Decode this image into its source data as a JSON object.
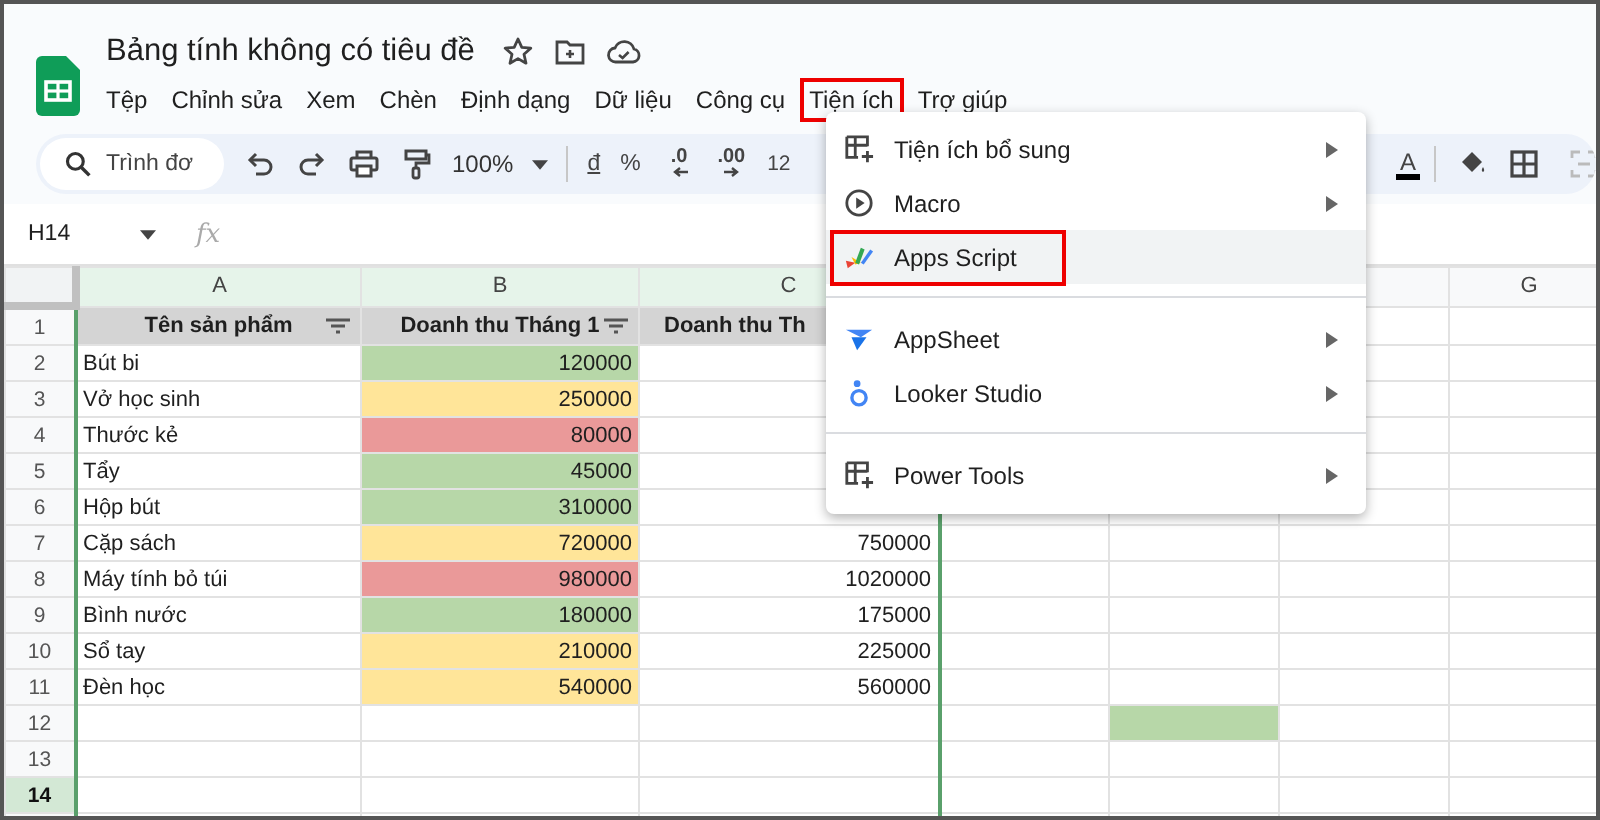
{
  "title": "Bảng tính không có tiêu đề",
  "menu_bar": [
    {
      "label": "Tệp",
      "annotated": false
    },
    {
      "label": "Chỉnh sửa",
      "annotated": false
    },
    {
      "label": "Xem",
      "annotated": false
    },
    {
      "label": "Chèn",
      "annotated": false
    },
    {
      "label": "Định dạng",
      "annotated": false
    },
    {
      "label": "Dữ liệu",
      "annotated": false
    },
    {
      "label": "Công cụ",
      "annotated": false
    },
    {
      "label": "Tiện ích",
      "annotated": true
    },
    {
      "label": "Trợ giúp",
      "annotated": false
    }
  ],
  "toolbar": {
    "search_placeholder": "Trình đơ",
    "zoom": "100%",
    "currency": "đ",
    "percent": "%",
    "decrease_decimals": ".0",
    "increase_decimals": ".00",
    "font_size": "12",
    "text_color": "A"
  },
  "name_box": "H14",
  "formula_label": "fx",
  "columns": [
    {
      "label": "A",
      "filtered": true
    },
    {
      "label": "B",
      "filtered": true
    },
    {
      "label": "C",
      "filtered": true
    },
    {},
    {},
    {
      "filtered": false
    },
    {
      "label": "G",
      "filtered": false
    }
  ],
  "header_row": {
    "number": "1",
    "selected": false,
    "cells": [
      {
        "text": "Tên sản phẩm",
        "filter": true
      },
      {
        "text": "Doanh thu Tháng 1",
        "filter": true
      },
      {
        "text": "Doanh thu Th"
      },
      null,
      null,
      null,
      null
    ]
  },
  "rows": [
    {
      "number": "2",
      "selected": false,
      "cells": [
        {
          "text": "Bút bi"
        },
        {
          "text": "120000",
          "color": "#b7d7a8"
        },
        null,
        null,
        null,
        null,
        null
      ]
    },
    {
      "number": "3",
      "selected": false,
      "cells": [
        {
          "text": "Vở học sinh"
        },
        {
          "text": "250000",
          "color": "#ffe599"
        },
        null,
        null,
        null,
        null,
        null
      ]
    },
    {
      "number": "4",
      "selected": false,
      "cells": [
        {
          "text": "Thước kẻ"
        },
        {
          "text": "80000",
          "color": "#ea9999"
        },
        null,
        null,
        null,
        null,
        null
      ]
    },
    {
      "number": "5",
      "selected": false,
      "cells": [
        {
          "text": "Tẩy"
        },
        {
          "text": "45000",
          "color": "#b7d7a8"
        },
        null,
        null,
        null,
        null,
        null
      ]
    },
    {
      "number": "6",
      "selected": false,
      "cells": [
        {
          "text": "Hộp bút"
        },
        {
          "text": "310000",
          "color": "#b7d7a8"
        },
        null,
        null,
        null,
        null,
        null
      ]
    },
    {
      "number": "7",
      "selected": false,
      "cells": [
        {
          "text": "Cặp sách"
        },
        {
          "text": "720000",
          "color": "#ffe599"
        },
        {
          "text": "750000"
        },
        null,
        null,
        null,
        null
      ]
    },
    {
      "number": "8",
      "selected": false,
      "cells": [
        {
          "text": "Máy tính bỏ túi"
        },
        {
          "text": "980000",
          "color": "#ea9999"
        },
        {
          "text": "1020000"
        },
        null,
        null,
        null,
        null
      ]
    },
    {
      "number": "9",
      "selected": false,
      "cells": [
        {
          "text": "Bình nước"
        },
        {
          "text": "180000",
          "color": "#b7d7a8"
        },
        {
          "text": "175000"
        },
        null,
        null,
        null,
        null
      ]
    },
    {
      "number": "10",
      "selected": false,
      "cells": [
        {
          "text": "Sổ tay"
        },
        {
          "text": "210000",
          "color": "#ffe599"
        },
        {
          "text": "225000"
        },
        null,
        null,
        null,
        null
      ]
    },
    {
      "number": "11",
      "selected": false,
      "cells": [
        {
          "text": "Đèn học"
        },
        {
          "text": "540000",
          "color": "#ffe599"
        },
        {
          "text": "560000"
        },
        null,
        null,
        null,
        null
      ]
    },
    {
      "number": "12",
      "selected": false,
      "cells": [
        null,
        null,
        null,
        null,
        {
          "color": "#b7d7a8"
        },
        null,
        null
      ]
    },
    {
      "number": "13",
      "selected": false,
      "cells": [
        null,
        null,
        null,
        null,
        null,
        null,
        null
      ]
    },
    {
      "number": "14",
      "selected": true,
      "cells": [
        null,
        null,
        null,
        null,
        null,
        null,
        null
      ]
    }
  ],
  "menu": [
    {
      "kind": "item",
      "label": "Tiện ích bổ sung",
      "submenu": true,
      "hovered": false,
      "annotated": false
    },
    {
      "kind": "item",
      "label": "Macro",
      "submenu": true,
      "hovered": false,
      "annotated": false
    },
    {
      "kind": "item",
      "label": "Apps Script",
      "submenu": false,
      "hovered": true,
      "annotated": true
    },
    {
      "kind": "divider"
    },
    {
      "kind": "item",
      "label": "AppSheet",
      "submenu": true,
      "hovered": false,
      "annotated": false
    },
    {
      "kind": "item",
      "label": "Looker Studio",
      "submenu": true,
      "hovered": false,
      "annotated": false
    },
    {
      "kind": "divider"
    },
    {
      "kind": "item",
      "label": "Power Tools",
      "submenu": true,
      "hovered": false,
      "annotated": false
    }
  ]
}
